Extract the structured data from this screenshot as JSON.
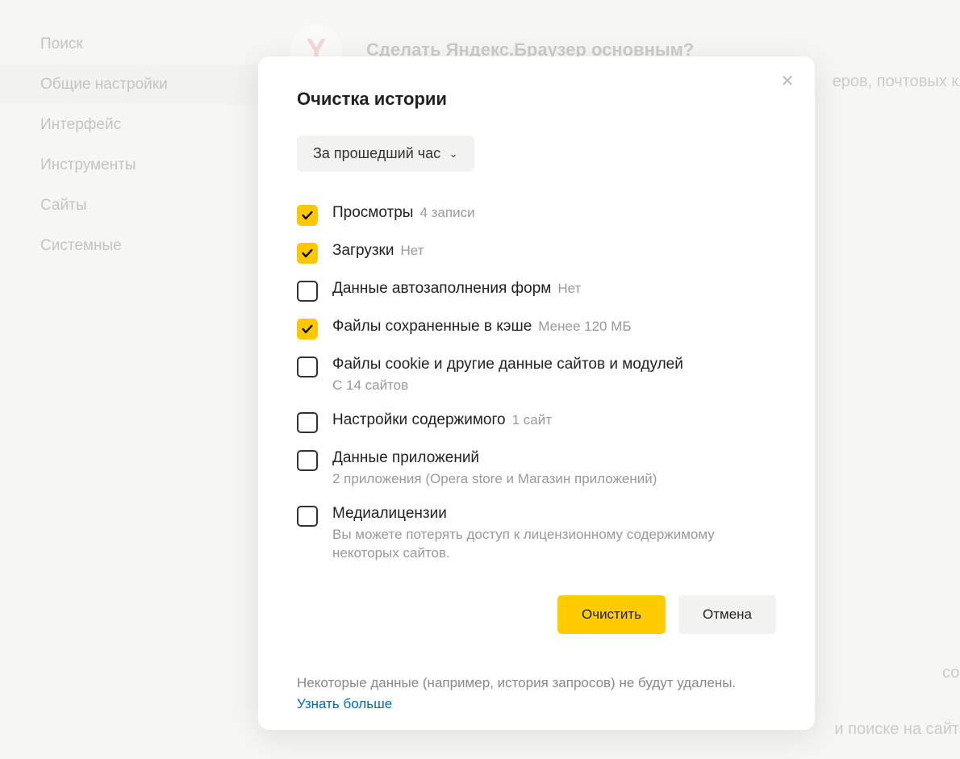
{
  "sidebar": {
    "items": [
      {
        "label": "Поиск"
      },
      {
        "label": "Общие настройки"
      },
      {
        "label": "Интерфейс"
      },
      {
        "label": "Инструменты"
      },
      {
        "label": "Сайты"
      },
      {
        "label": "Системные"
      }
    ],
    "active_index": 1
  },
  "main": {
    "banner_title": "Сделать Яндекс.Браузер основным?",
    "logo_letter": "Y",
    "bg_right": "еров, почтовых кл",
    "bg_bottom1": "сов",
    "bg_bottom2": "и поиске на сайте"
  },
  "dialog": {
    "title": "Очистка истории",
    "dropdown_label": "За прошедший час",
    "options": [
      {
        "label": "Просмотры",
        "hint_inline": "4 записи",
        "checked": true
      },
      {
        "label": "Загрузки",
        "hint_inline": "Нет",
        "checked": true
      },
      {
        "label": "Данные автозаполнения форм",
        "hint_inline": "Нет",
        "checked": false
      },
      {
        "label": "Файлы сохраненные в кэше",
        "hint_inline": "Менее 120 МБ",
        "checked": true
      },
      {
        "label": "Файлы cookie и другие данные сайтов и модулей",
        "sub": "С 14 сайтов",
        "checked": false
      },
      {
        "label": "Настройки содержимого",
        "hint_inline": "1 сайт",
        "checked": false
      },
      {
        "label": "Данные приложений",
        "sub": "2 приложения (Opera store и Магазин приложений)",
        "checked": false
      },
      {
        "label": "Медиалицензии",
        "sub": "Вы можете потерять доступ к лицензионному содержимому некоторых сайтов.",
        "checked": false
      }
    ],
    "primary_button": "Очистить",
    "secondary_button": "Отмена",
    "note_text": "Некоторые данные (например, история запросов) не будут удалены.",
    "note_link": "Узнать больше"
  }
}
